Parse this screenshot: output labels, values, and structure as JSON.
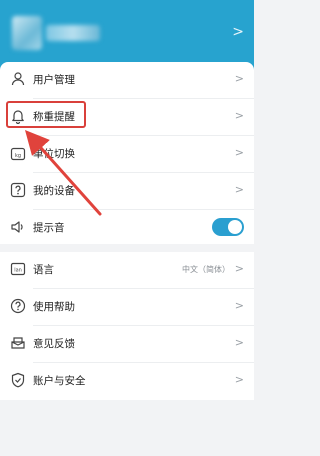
{
  "colors": {
    "header": "#27a3cf",
    "accent": "#2a9fd0",
    "highlight": "#d9403b"
  },
  "header": {
    "chevron": ">"
  },
  "menu_group1": [
    {
      "label": "用户管理",
      "icon": "person-icon"
    },
    {
      "label": "称重提醒",
      "icon": "bell-icon"
    },
    {
      "label": "单位切换",
      "icon": "unit-scale-icon"
    },
    {
      "label": "我的设备",
      "icon": "device-question-icon"
    },
    {
      "label": "提示音",
      "icon": "speaker-icon",
      "toggle_on": true
    }
  ],
  "menu_group2": [
    {
      "label": "语言",
      "icon": "language-icon",
      "value": "中文（简体）"
    },
    {
      "label": "使用帮助",
      "icon": "help-icon"
    },
    {
      "label": "意见反馈",
      "icon": "feedback-icon"
    },
    {
      "label": "账户与安全",
      "icon": "shield-icon"
    }
  ],
  "chevron": ">"
}
